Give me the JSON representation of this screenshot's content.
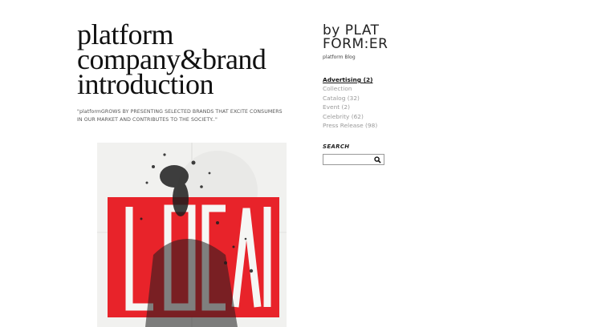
{
  "hero": {
    "title_line1": "platform",
    "title_line2": "company&brand",
    "title_line3": "introduction",
    "quote_line1": "\"platformGROWS BY PRESENTING SELECTED BRANDS THAT EXCITE CONSUMERS",
    "quote_line2": "IN OUR MARKET AND CONTRIBUTES TO THE SOCIETY..\""
  },
  "brand": {
    "logo_line1": "by PLAT",
    "logo_line2": "FORM:ER",
    "subtitle": "platform Blog"
  },
  "categories": [
    {
      "label": "Advertising (2)",
      "active": true
    },
    {
      "label": "Collection",
      "active": false
    },
    {
      "label": "Catalog (32)",
      "active": false
    },
    {
      "label": "Event (2)",
      "active": false
    },
    {
      "label": "Celebrity (62)",
      "active": false
    },
    {
      "label": "Press Release (98)",
      "active": false
    }
  ],
  "search": {
    "label": "SEARCH",
    "value": "",
    "placeholder": "",
    "icon": "search-icon"
  },
  "poster": {
    "text": "LOCAL",
    "accent_color": "#e8232a",
    "paper_color": "#f1f1ef",
    "ink_color": "#1e1e1e"
  }
}
